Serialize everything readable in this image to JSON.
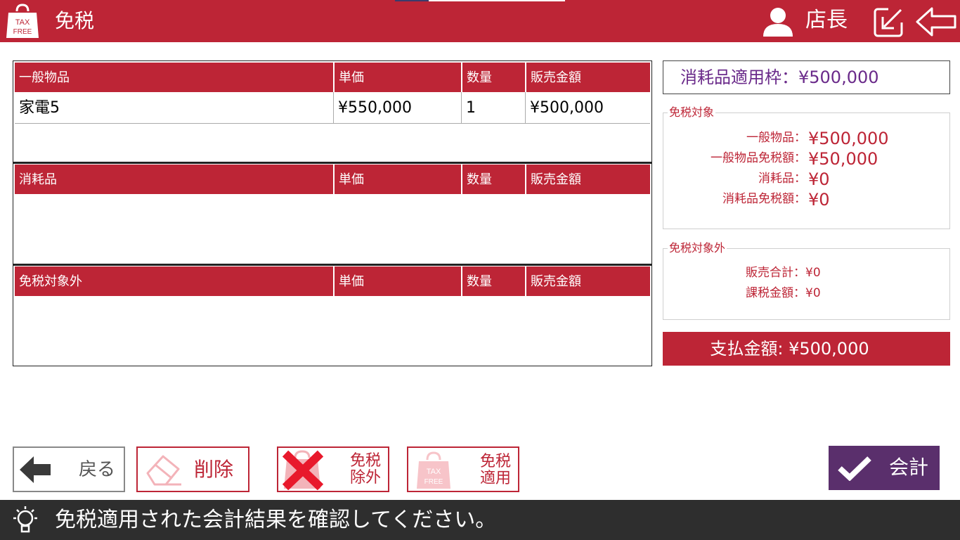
{
  "header": {
    "logo_text_top": "TAX",
    "logo_text_bottom": "FREE",
    "title": "免税",
    "user_name": "店長",
    "color": "#bd2536"
  },
  "tables": {
    "general": {
      "headers": [
        "一般物品",
        "単価",
        "数量",
        "販売金額"
      ],
      "rows": [
        {
          "name": "家電5",
          "unit_price": "¥550,000",
          "qty": "1",
          "amount": "¥500,000"
        }
      ]
    },
    "consumables": {
      "headers": [
        "消耗品",
        "単価",
        "数量",
        "販売金額"
      ],
      "rows": []
    },
    "non_tax_free": {
      "headers": [
        "免税対象外",
        "単価",
        "数量",
        "販売金額"
      ],
      "rows": []
    }
  },
  "right_panel": {
    "limit_label": "消耗品適用枠：¥500,000",
    "tax_free": {
      "legend": "免税対象",
      "general_label": "一般物品：",
      "general_value": "¥500,000",
      "general_exempt_label": "一般物品免税額：",
      "general_exempt_value": "¥50,000",
      "consumable_label": "消耗品：",
      "consumable_value": "¥0",
      "consumable_exempt_label": "消耗品免税額：",
      "consumable_exempt_value": "¥0"
    },
    "non_tax_free": {
      "legend": "免税対象外",
      "sales_total": "販売合計：¥0",
      "taxed_amount": "課税金額：¥0"
    },
    "payment": "支払金額: ¥500,000"
  },
  "buttons": {
    "back": "戻る",
    "delete": "削除",
    "exclude_line1": "免税",
    "exclude_line2": "除外",
    "apply_line1": "免税",
    "apply_line2": "適用",
    "checkout": "会計",
    "checkout_color": "#5a2f6c"
  },
  "footer": {
    "message": "免税適用された会計結果を確認してください。"
  }
}
